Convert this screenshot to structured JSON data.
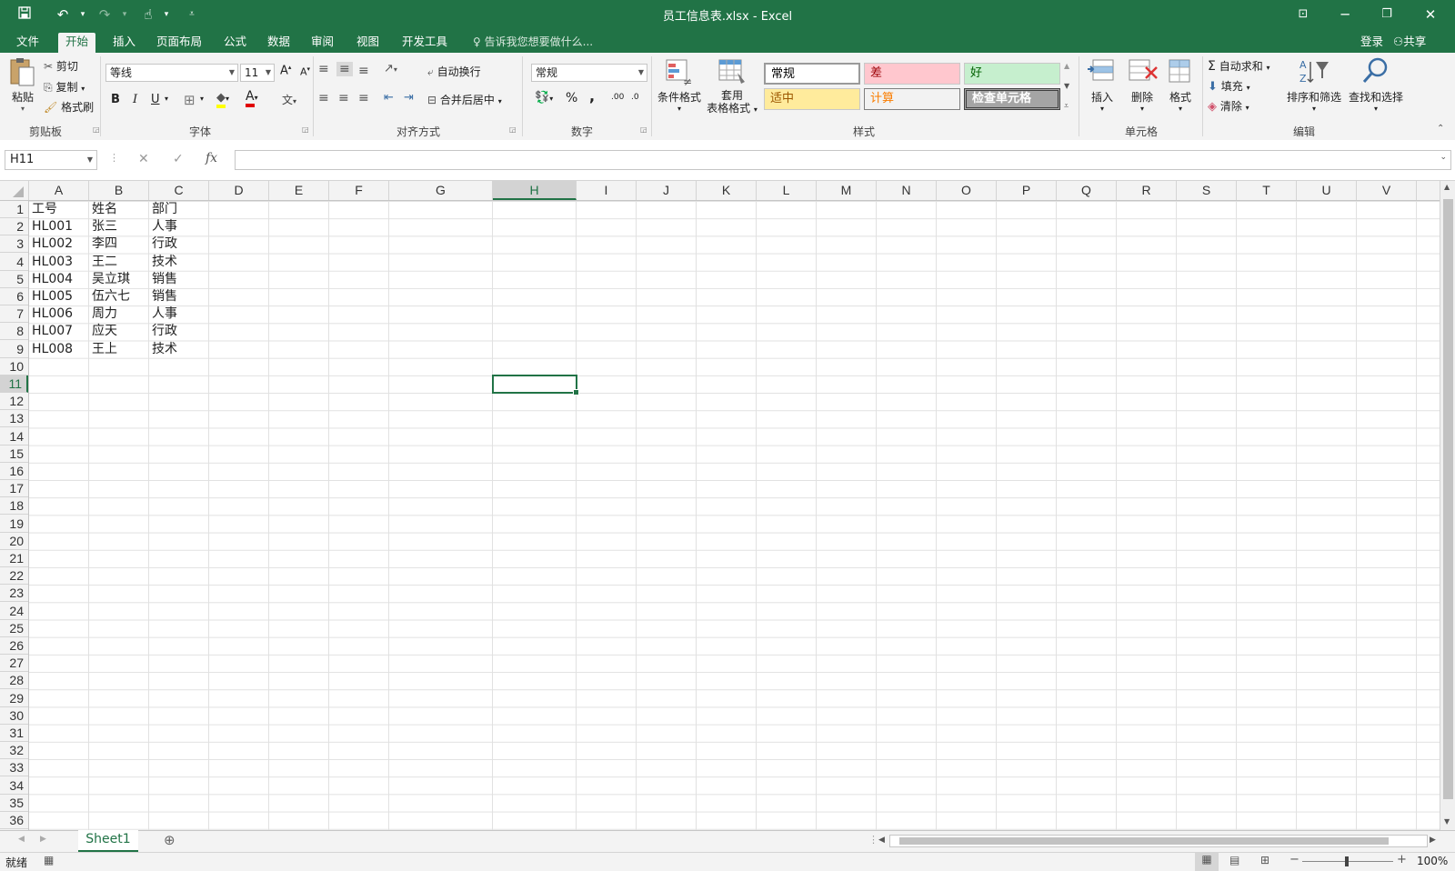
{
  "titlebar": {
    "title": "员工信息表.xlsx - Excel",
    "save_icon": "save-icon",
    "undo_icon": "undo-icon",
    "redo_icon": "redo-icon",
    "touch_icon": "touch-mode-icon",
    "customize_icon": "customize-toolbar-icon"
  },
  "tabs": [
    {
      "label": "文件",
      "active": false
    },
    {
      "label": "开始",
      "active": true
    },
    {
      "label": "插入",
      "active": false
    },
    {
      "label": "页面布局",
      "active": false
    },
    {
      "label": "公式",
      "active": false
    },
    {
      "label": "数据",
      "active": false
    },
    {
      "label": "审阅",
      "active": false
    },
    {
      "label": "视图",
      "active": false
    },
    {
      "label": "开发工具",
      "active": false
    }
  ],
  "tellme": "告诉我您想要做什么...",
  "account": {
    "login": "登录",
    "share": "共享"
  },
  "ribbon": {
    "clipboard": {
      "paste": "粘贴",
      "cut": "剪切",
      "copy": "复制",
      "format_painter": "格式刷",
      "label": "剪贴板"
    },
    "font": {
      "name": "等线",
      "size": "11",
      "label": "字体",
      "bold": "B",
      "italic": "I",
      "underline": "U",
      "font_color_letter": "A",
      "grow": "A",
      "shrink": "A",
      "phonetic": "文"
    },
    "alignment": {
      "wrap_text": "自动换行",
      "merge_center": "合并后居中",
      "label": "对齐方式"
    },
    "number": {
      "format": "常规",
      "percent": "%",
      "comma": ",",
      "inc_decimal": ".00",
      "dec_decimal": ".0",
      "label": "数字"
    },
    "styles": {
      "conditional": "条件格式",
      "table_format_line1": "套用",
      "table_format_line2": "表格格式",
      "cells": [
        "常规",
        "差",
        "好",
        "适中",
        "计算",
        "检查单元格"
      ],
      "label": "样式"
    },
    "cells": {
      "insert": "插入",
      "delete": "删除",
      "format": "格式",
      "label": "单元格"
    },
    "editing": {
      "autosum": "自动求和",
      "fill": "填充",
      "clear": "清除",
      "sort_filter": "排序和筛选",
      "find_select": "查找和选择",
      "label": "编辑"
    }
  },
  "formula_bar": {
    "name_box": "H11",
    "fx": "fx",
    "content": ""
  },
  "grid": {
    "columns": [
      "A",
      "B",
      "C",
      "D",
      "E",
      "F",
      "G",
      "H",
      "I",
      "J",
      "K",
      "L",
      "M",
      "N",
      "O",
      "P",
      "Q",
      "R",
      "S",
      "T",
      "U",
      "V"
    ],
    "selected_column": "H",
    "selected_row": 11,
    "row_count": 36,
    "data": [
      [
        "工号",
        "姓名",
        "部门"
      ],
      [
        "HL001",
        "张三",
        "人事"
      ],
      [
        "HL002",
        "李四",
        "行政"
      ],
      [
        "HL003",
        "王二",
        "技术"
      ],
      [
        "HL004",
        "吴立琪",
        "销售"
      ],
      [
        "HL005",
        "伍六七",
        "销售"
      ],
      [
        "HL006",
        "周力",
        "人事"
      ],
      [
        "HL007",
        "应天",
        "行政"
      ],
      [
        "HL008",
        "王上",
        "技术"
      ]
    ]
  },
  "sheets": [
    {
      "name": "Sheet1",
      "active": true
    }
  ],
  "statusbar": {
    "ready": "就绪",
    "zoom": "100%"
  },
  "colors": {
    "accent": "#217346"
  }
}
